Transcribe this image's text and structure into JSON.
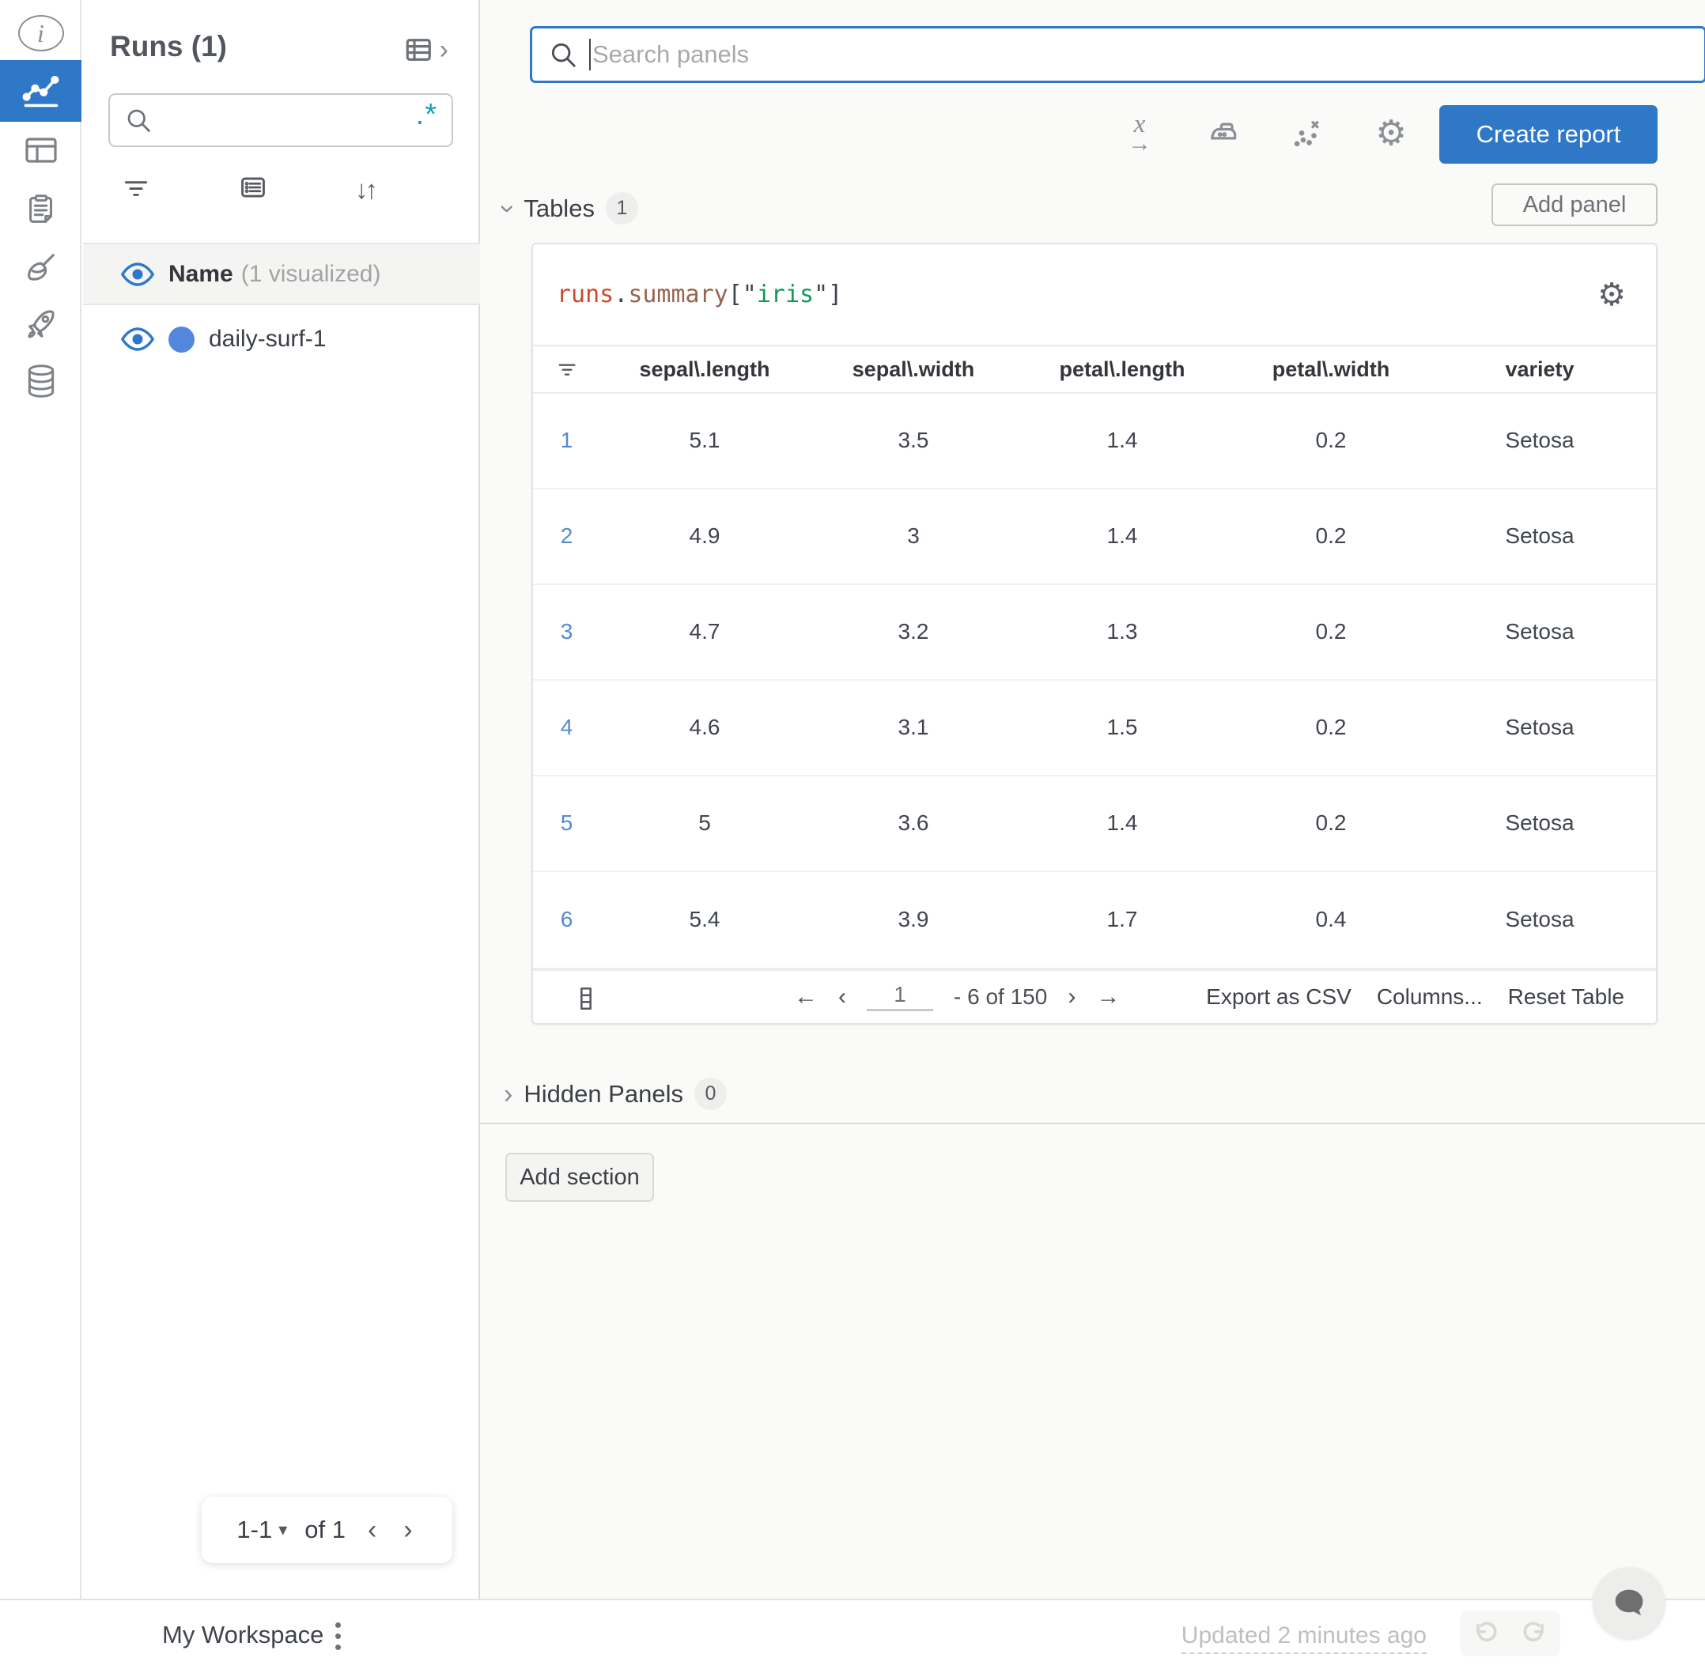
{
  "runs_panel": {
    "title": "Runs (1)",
    "search_placeholder": "",
    "regex_glyph": ".*",
    "sort_glyph": "↓↑",
    "name_header": {
      "label": "Name",
      "sub": "(1 visualized)"
    },
    "runs": [
      {
        "name": "daily-surf-1",
        "color": "#5387dd"
      }
    ],
    "pagination": {
      "range": "1-1",
      "caret": "▾",
      "of_label": "of 1",
      "prev": "‹",
      "next": "›"
    }
  },
  "topbar": {
    "search_placeholder": "Search panels",
    "create_report_label": "Create report",
    "gear_glyph": "⚙",
    "xaxis_letter": "x",
    "xaxis_arrow": "→"
  },
  "sections": {
    "tables": {
      "label": "Tables",
      "count": "1",
      "chevron": "›"
    },
    "hidden": {
      "label": "Hidden Panels",
      "count": "0",
      "chevron": "›"
    },
    "add_panel_label": "Add panel",
    "add_section_label": "Add section"
  },
  "table_panel": {
    "title": {
      "runs": "runs",
      "dot": ".",
      "summary": "summary",
      "open": "[\"",
      "key": "iris",
      "close": "\"]"
    },
    "gear_glyph": "⚙",
    "columns": [
      "sepal\\.length",
      "sepal\\.width",
      "petal\\.length",
      "petal\\.width",
      "variety"
    ],
    "rows": [
      {
        "index": "1",
        "values": [
          "5.1",
          "3.5",
          "1.4",
          "0.2",
          "Setosa"
        ]
      },
      {
        "index": "2",
        "values": [
          "4.9",
          "3",
          "1.4",
          "0.2",
          "Setosa"
        ]
      },
      {
        "index": "3",
        "values": [
          "4.7",
          "3.2",
          "1.3",
          "0.2",
          "Setosa"
        ]
      },
      {
        "index": "4",
        "values": [
          "4.6",
          "3.1",
          "1.5",
          "0.2",
          "Setosa"
        ]
      },
      {
        "index": "5",
        "values": [
          "5",
          "3.6",
          "1.4",
          "0.2",
          "Setosa"
        ]
      },
      {
        "index": "6",
        "values": [
          "5.4",
          "3.9",
          "1.7",
          "0.4",
          "Setosa"
        ]
      }
    ],
    "footer": {
      "page": "1",
      "range_text": "- 6 of 150",
      "arrow_left": "←",
      "arrow_right": "→",
      "chev_left": "‹",
      "chev_right": "›",
      "export_label": "Export as CSV",
      "columns_label": "Columns...",
      "reset_label": "Reset Table"
    }
  },
  "statusbar": {
    "workspace_label": "My Workspace",
    "updated_text": "Updated 2 minutes ago"
  }
}
